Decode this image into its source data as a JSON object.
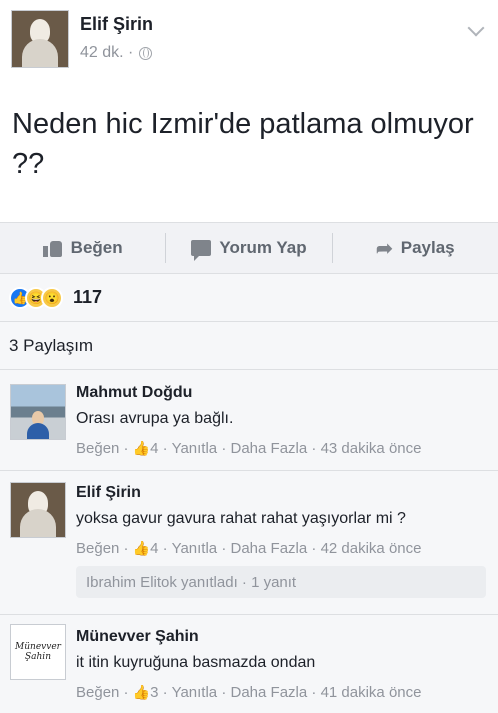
{
  "post": {
    "author": "Elif Şirin",
    "time": "42 dk. ·",
    "text": "Neden hic Izmir'de patlama olmuyor ??"
  },
  "actions": {
    "like": "Beğen",
    "comment": "Yorum Yap",
    "share": "Paylaş"
  },
  "reactions": {
    "icons": [
      "like-icon",
      "haha-icon",
      "wow-icon"
    ],
    "count": "117"
  },
  "shares": "3 Paylaşım",
  "comments": [
    {
      "name": "Mahmut Doğdu",
      "text": "Orası avrupa ya bağlı.",
      "like": "Beğen",
      "likes": "4",
      "reply": "Yanıtla",
      "more": "Daha Fazla",
      "time": "43 dakika önce"
    },
    {
      "name": "Elif Şirin",
      "text": "yoksa gavur gavura rahat rahat yaşıyorlar mi ?",
      "like": "Beğen",
      "likes": "4",
      "reply": "Yanıtla",
      "more": "Daha Fazla",
      "time": "42 dakika önce",
      "reply_summary": "Ibrahim Elitok yanıtladı · 1 yanıt"
    },
    {
      "name": "Münevver Şahin",
      "text": "it itin kuyruğuna basmazda ondan",
      "like": "Beğen",
      "likes": "3",
      "reply": "Yanıtla",
      "more": "Daha Fazla",
      "time": "41 dakika önce",
      "avatar_text": "Münevver Şahin"
    }
  ],
  "colors": {
    "accent": "#1877f2",
    "meta": "#90949c",
    "text": "#1d2129",
    "bar": "#f1f2f5"
  }
}
